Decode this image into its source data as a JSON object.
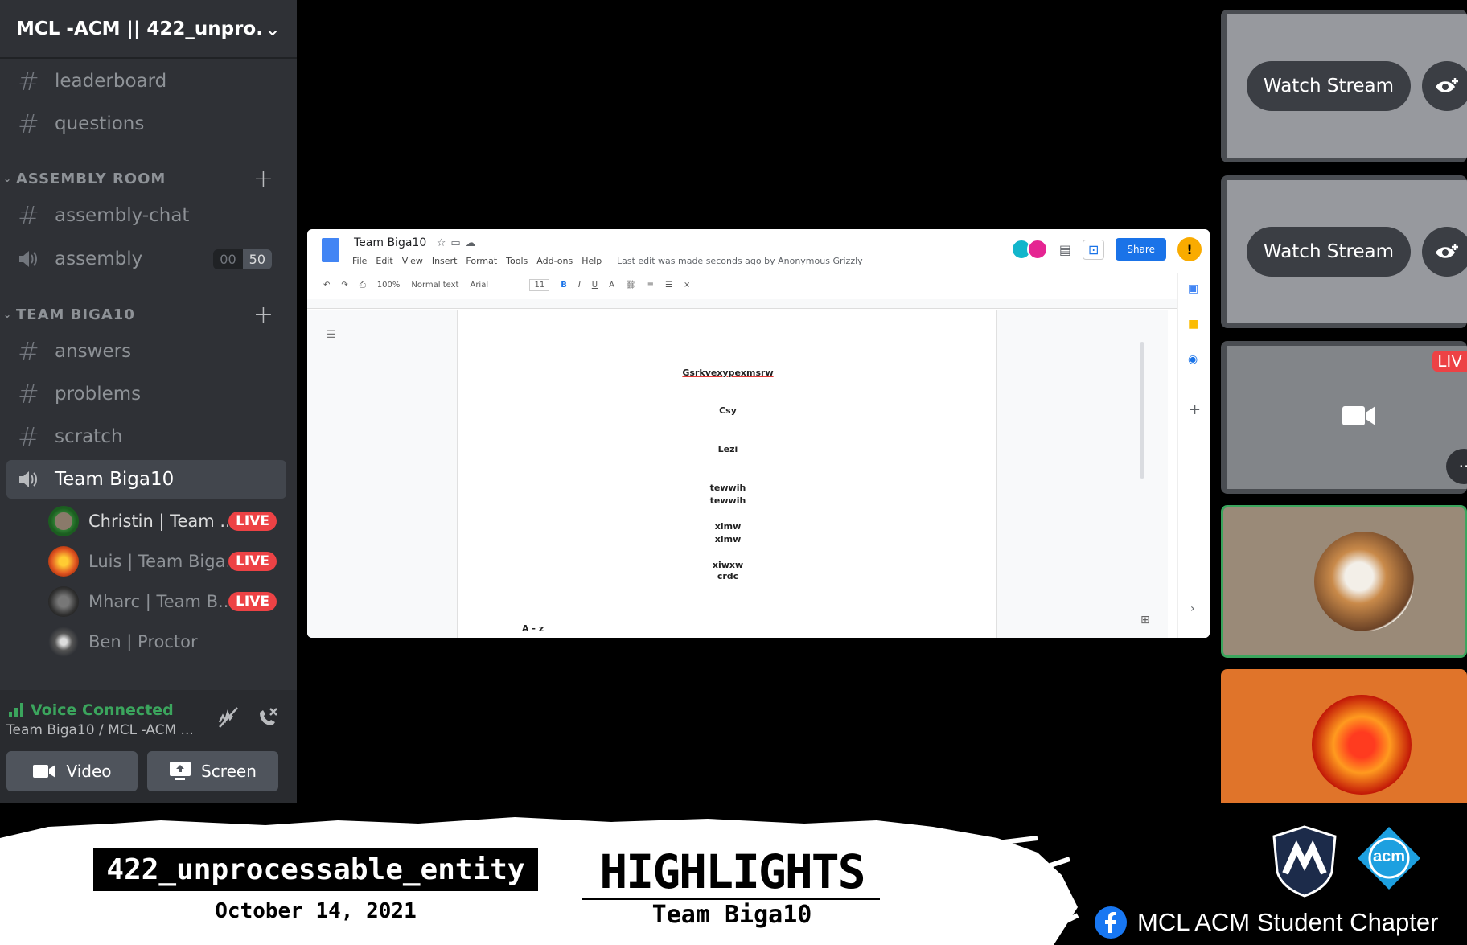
{
  "server": {
    "name": "MCL -ACM || 422_unpro..."
  },
  "channels_top": [
    {
      "name": "leaderboard"
    },
    {
      "name": "questions"
    }
  ],
  "categories": {
    "assembly_room": "ASSEMBLY ROOM",
    "team_biga10": "TEAM BIGA10"
  },
  "assembly": {
    "text_channel": "assembly-chat",
    "voice_channel": "assembly",
    "user_count": "00",
    "user_limit": "50"
  },
  "team_channels": [
    {
      "name": "answers"
    },
    {
      "name": "problems"
    },
    {
      "name": "scratch"
    }
  ],
  "active_voice_channel": "Team Biga10",
  "voice_users": [
    {
      "name": "Christin | Team ...",
      "live": "LIVE"
    },
    {
      "name": "Luis | Team Biga...",
      "live": "LIVE"
    },
    {
      "name": "Mharc | Team B...",
      "live": "LIVE"
    },
    {
      "name": "Ben | Proctor",
      "live": ""
    }
  ],
  "voice_panel": {
    "status": "Voice Connected",
    "location": "Team Biga10 / MCL -ACM ...",
    "video_label": "Video",
    "screen_label": "Screen"
  },
  "doc": {
    "title": "Team Biga10",
    "menu": [
      "File",
      "Edit",
      "View",
      "Insert",
      "Format",
      "Tools",
      "Add-ons",
      "Help"
    ],
    "last_edit": "Last edit was made seconds ago by Anonymous Grizzly",
    "share_label": "Share",
    "zoom": "100%",
    "style": "Normal text",
    "font": "Arial",
    "font_size": "11",
    "lines": [
      "Gsrkvexypexmsrw",
      "Csy",
      "Lezi",
      "tewwih",
      "tewwih",
      "xlmw",
      "xlmw",
      "xiwxw",
      "crdc"
    ],
    "footer_text": "A - z"
  },
  "tiles": {
    "watch_label": "Watch Stream",
    "live_label": "LIV"
  },
  "banner": {
    "tag": "422_unprocessable_entity",
    "date": "October 14, 2021",
    "title": "HIGHLIGHTS",
    "subtitle": "Team Biga10",
    "org": "MCL ACM Student Chapter",
    "acm_logo_text": "acm"
  },
  "colors": {
    "live": "#ed4245",
    "voice_green": "#3ba55d",
    "share_blue": "#1a73e8",
    "speaking_border": "#3ba55d",
    "orange_tile": "#e0742a"
  }
}
